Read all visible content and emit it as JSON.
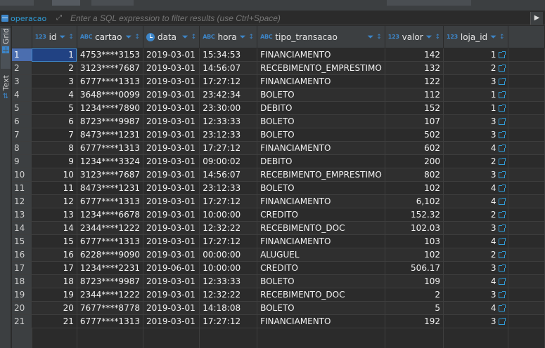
{
  "filter_bar": {
    "entity": "operacao",
    "placeholder": "Enter a SQL expression to filter results (use Ctrl+Space)"
  },
  "side_tabs": [
    "Grid",
    "Text"
  ],
  "columns": [
    {
      "name": "id",
      "type": "123"
    },
    {
      "name": "cartao",
      "type": "ABC"
    },
    {
      "name": "data",
      "type": "date"
    },
    {
      "name": "hora",
      "type": "ABC"
    },
    {
      "name": "tipo_transacao",
      "type": "ABC"
    },
    {
      "name": "valor",
      "type": "123"
    },
    {
      "name": "loja_id",
      "type": "123"
    }
  ],
  "rows": [
    [
      "1",
      "4753****3153",
      "2019-03-01",
      "15:34:53",
      "FINANCIAMENTO",
      "142",
      "1"
    ],
    [
      "2",
      "3123****7687",
      "2019-03-01",
      "14:56:07",
      "RECEBIMENTO_EMPRESTIMO",
      "132",
      "2"
    ],
    [
      "3",
      "6777****1313",
      "2019-03-01",
      "17:27:12",
      "FINANCIAMENTO",
      "122",
      "3"
    ],
    [
      "4",
      "3648****0099",
      "2019-03-01",
      "23:42:34",
      "BOLETO",
      "112",
      "1"
    ],
    [
      "5",
      "1234****7890",
      "2019-03-01",
      "23:30:00",
      "DEBITO",
      "152",
      "1"
    ],
    [
      "6",
      "8723****9987",
      "2019-03-01",
      "12:33:33",
      "BOLETO",
      "107",
      "3"
    ],
    [
      "7",
      "8473****1231",
      "2019-03-01",
      "23:12:33",
      "BOLETO",
      "502",
      "3"
    ],
    [
      "8",
      "6777****1313",
      "2019-03-01",
      "17:27:12",
      "FINANCIAMENTO",
      "602",
      "4"
    ],
    [
      "9",
      "1234****3324",
      "2019-03-01",
      "09:00:02",
      "DEBITO",
      "200",
      "2"
    ],
    [
      "10",
      "3123****7687",
      "2019-03-01",
      "14:56:07",
      "RECEBIMENTO_EMPRESTIMO",
      "802",
      "3"
    ],
    [
      "11",
      "8473****1231",
      "2019-03-01",
      "23:12:33",
      "BOLETO",
      "102",
      "4"
    ],
    [
      "12",
      "6777****1313",
      "2019-03-01",
      "17:27:12",
      "FINANCIAMENTO",
      "6,102",
      "4"
    ],
    [
      "13",
      "1234****6678",
      "2019-03-01",
      "10:00:00",
      "CREDITO",
      "152.32",
      "2"
    ],
    [
      "14",
      "2344****1222",
      "2019-03-01",
      "12:32:22",
      "RECEBIMENTO_DOC",
      "102.03",
      "3"
    ],
    [
      "15",
      "6777****1313",
      "2019-03-01",
      "17:27:12",
      "FINANCIAMENTO",
      "103",
      "4"
    ],
    [
      "16",
      "6228****9090",
      "2019-03-01",
      "00:00:00",
      "ALUGUEL",
      "102",
      "2"
    ],
    [
      "17",
      "1234****2231",
      "2019-06-01",
      "10:00:00",
      "CREDITO",
      "506.17",
      "3"
    ],
    [
      "18",
      "8723****9987",
      "2019-03-01",
      "12:33:33",
      "BOLETO",
      "109",
      "4"
    ],
    [
      "19",
      "2344****1222",
      "2019-03-01",
      "12:32:22",
      "RECEBIMENTO_DOC",
      "2",
      "3"
    ],
    [
      "20",
      "7677****8778",
      "2019-03-01",
      "14:18:08",
      "BOLETO",
      "5",
      "4"
    ],
    [
      "21",
      "6777****1313",
      "2019-03-01",
      "17:27:12",
      "FINANCIAMENTO",
      "192",
      "3"
    ]
  ],
  "colors": {
    "background": "#2b2b2b",
    "header": "#3c3f41",
    "accent": "#3d86c9",
    "link": "#2f9bd6",
    "selection": "#4b6eaf"
  }
}
